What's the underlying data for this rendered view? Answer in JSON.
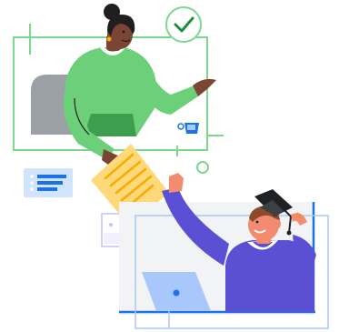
{
  "illustration": {
    "colors": {
      "frame_green": "#7BD88F",
      "check_green": "#1E8E3E",
      "teacher_shirt": "#6CCF7A",
      "teacher_shirt_shadow": "#3E9E4F",
      "skin_dark": "#7A4533",
      "hair": "#1F1F1F",
      "chair": "#9AA0A6",
      "document": "#FDD97A",
      "document_lines": "#F9AB00",
      "graduate_sweater": "#5B4FD4",
      "skin_light": "#F28B70",
      "cap": "#202124",
      "tassel": "#F28B24",
      "laptop": "#A8C7FA",
      "panel_gray": "#F1F3F4",
      "blue_accent": "#1A73E8",
      "chat_card": "#D2E3FC",
      "lavender": "#C7C0F7"
    },
    "icons": [
      "checkmark-icon",
      "coffee-cup-icon",
      "chat-card-icon",
      "graduation-cap-icon",
      "laptop-icon",
      "document-icon"
    ]
  }
}
